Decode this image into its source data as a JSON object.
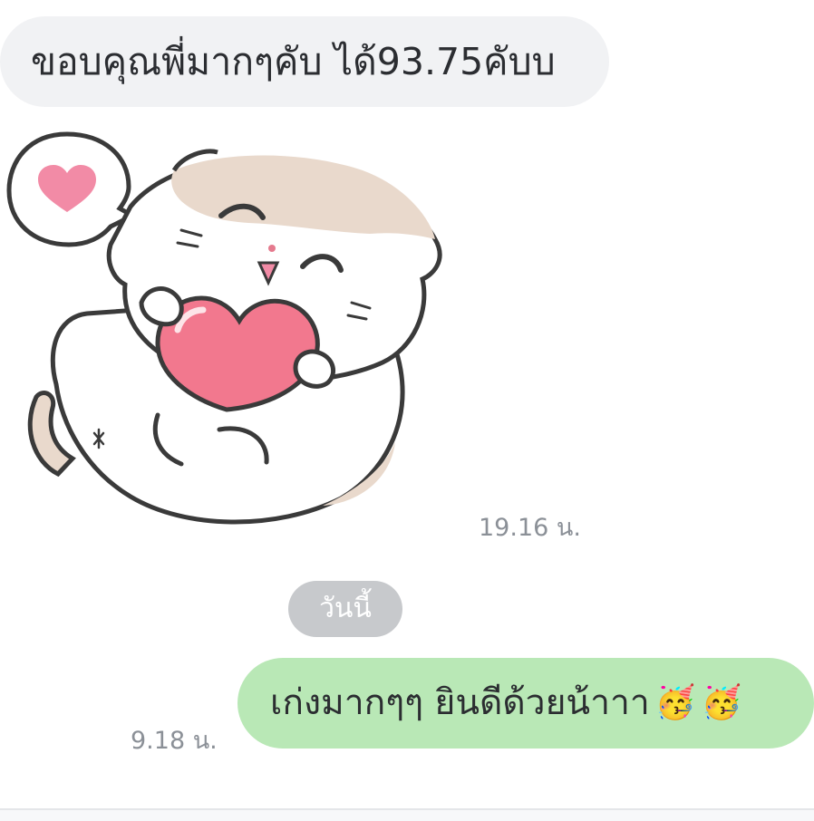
{
  "messages": {
    "incoming_text": "ขอบคุณพี่มากๆคับ ได้93.75คับบ",
    "incoming_time": "19.16 น.",
    "date_separator": "วันนี้",
    "outgoing_text": "เก่งมากๆๆ ยินดีด้วยน้าาา",
    "outgoing_emoji_1": "🥳",
    "outgoing_emoji_2": "🥳",
    "outgoing_time": "9.18 น."
  },
  "colors": {
    "incoming_bubble": "#f1f2f4",
    "outgoing_bubble": "#b9e8b6",
    "date_chip": "#c7c9cc",
    "timestamp": "#8b9097"
  },
  "sticker": {
    "icon": "cat-hugging-heart-sticker"
  }
}
